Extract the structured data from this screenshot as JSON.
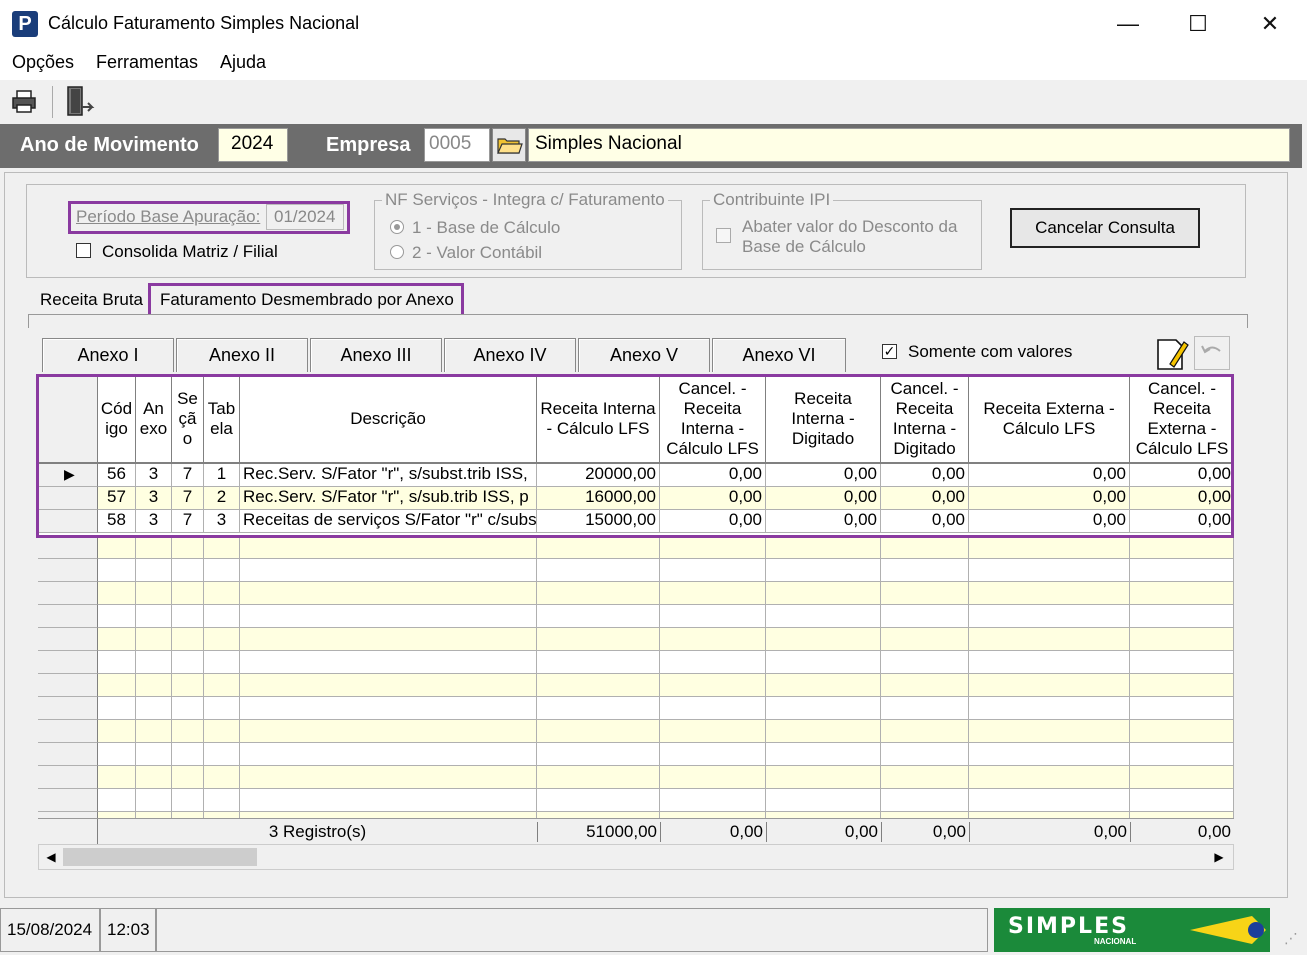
{
  "window": {
    "title": "Cálculo Faturamento Simples Nacional",
    "app_icon_letter": "P",
    "minimize": "—",
    "maximize": "☐",
    "close": "✕"
  },
  "menu": [
    "Opções",
    "Ferramentas",
    "Ajuda"
  ],
  "header": {
    "ano_label": "Ano de Movimento",
    "ano_value": "2024",
    "empresa_label": "Empresa",
    "empresa_code": "0005",
    "empresa_name": "Simples Nacional"
  },
  "filters": {
    "periodo_label": "Período Base Apuração:",
    "periodo_value": "01/2024",
    "consolida_label": "Consolida Matriz / Filial",
    "nf_group_title": "NF Serviços - Integra c/ Faturamento",
    "nf_option1": "1 -  Base de Cálculo",
    "nf_option2": "2 -  Valor Contábil",
    "ipi_group_title": "Contribuinte IPI",
    "ipi_checkbox_label_line1": "Abater valor do Desconto da",
    "ipi_checkbox_label_line2": "Base de Cálculo",
    "cancel_button": "Cancelar Consulta"
  },
  "tabs": [
    "Receita Bruta",
    "Faturamento Desmembrado por Anexo"
  ],
  "anexo_tabs": [
    "Anexo I",
    "Anexo II",
    "Anexo III",
    "Anexo IV",
    "Anexo V",
    "Anexo VI"
  ],
  "somente_label": "Somente com valores",
  "grid": {
    "headers": {
      "codigo": "Cód igo",
      "anexo": "An exo",
      "secao": "Se çã o",
      "tabela": "Tab ela",
      "descricao": "Descrição",
      "receita_interna_calc": "Receita Interna - Cálculo LFS",
      "cancel_receita_interna_calc": "Cancel. - Receita Interna - Cálculo LFS",
      "receita_interna_dig": "Receita Interna - Digitado",
      "cancel_receita_interna_dig": "Cancel. - Receita Interna - Digitado",
      "receita_externa_calc": "Receita Externa - Cálculo LFS",
      "cancel_receita_externa_calc": "Cancel. - Receita Externa - Cálculo LFS"
    },
    "rows": [
      {
        "codigo": "56",
        "anexo": "3",
        "secao": "7",
        "tabela": "1",
        "descricao": "Rec.Serv. S/Fator \"r\", s/subst.trib ISS,",
        "c1": "20000,00",
        "c2": "0,00",
        "c3": "0,00",
        "c4": "0,00",
        "c5": "0,00",
        "c6": "0,00"
      },
      {
        "codigo": "57",
        "anexo": "3",
        "secao": "7",
        "tabela": "2",
        "descricao": "Rec.Serv. S/Fator \"r\", s/sub.trib ISS, p",
        "c1": "16000,00",
        "c2": "0,00",
        "c3": "0,00",
        "c4": "0,00",
        "c5": "0,00",
        "c6": "0,00"
      },
      {
        "codigo": "58",
        "anexo": "3",
        "secao": "7",
        "tabela": "3",
        "descricao": "Receitas de serviços S/Fator \"r\" c/subs",
        "c1": "15000,00",
        "c2": "0,00",
        "c3": "0,00",
        "c4": "0,00",
        "c5": "0,00",
        "c6": "0,00"
      }
    ],
    "footer": {
      "count": "3 Registro(s)",
      "c1": "51000,00",
      "c2": "0,00",
      "c3": "0,00",
      "c4": "0,00",
      "c5": "0,00",
      "c6": "0,00"
    }
  },
  "status": {
    "date": "15/08/2024",
    "time": "12:03",
    "logo_text": "SIMPLES",
    "logo_sub": "NACIONAL"
  }
}
